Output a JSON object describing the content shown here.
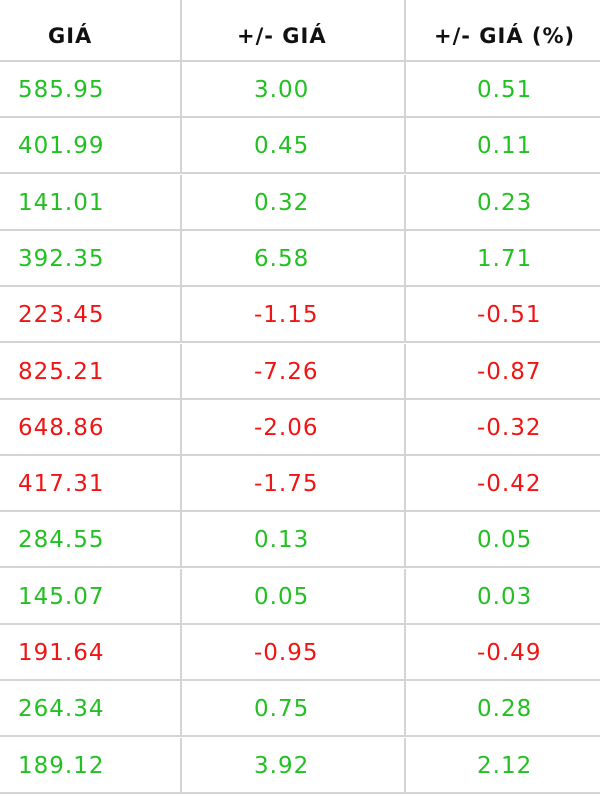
{
  "table": {
    "headers": [
      "GIÁ",
      "+/-  GIÁ",
      "+/-  GIÁ (%)"
    ],
    "rows": [
      {
        "price": "585.95",
        "change": "3.00",
        "change_pct": "0.51",
        "direction": "up"
      },
      {
        "price": "401.99",
        "change": "0.45",
        "change_pct": "0.11",
        "direction": "up"
      },
      {
        "price": "141.01",
        "change": "0.32",
        "change_pct": "0.23",
        "direction": "up"
      },
      {
        "price": "392.35",
        "change": "6.58",
        "change_pct": "1.71",
        "direction": "up"
      },
      {
        "price": "223.45",
        "change": "-1.15",
        "change_pct": "-0.51",
        "direction": "down"
      },
      {
        "price": "825.21",
        "change": "-7.26",
        "change_pct": "-0.87",
        "direction": "down"
      },
      {
        "price": "648.86",
        "change": "-2.06",
        "change_pct": "-0.32",
        "direction": "down"
      },
      {
        "price": "417.31",
        "change": "-1.75",
        "change_pct": "-0.42",
        "direction": "down"
      },
      {
        "price": "284.55",
        "change": "0.13",
        "change_pct": "0.05",
        "direction": "up"
      },
      {
        "price": "145.07",
        "change": "0.05",
        "change_pct": "0.03",
        "direction": "up"
      },
      {
        "price": "191.64",
        "change": "-0.95",
        "change_pct": "-0.49",
        "direction": "down"
      },
      {
        "price": "264.34",
        "change": "0.75",
        "change_pct": "0.28",
        "direction": "up"
      },
      {
        "price": "189.12",
        "change": "3.92",
        "change_pct": "2.12",
        "direction": "up"
      }
    ]
  },
  "colors": {
    "up": "#22c022",
    "down": "#f01515",
    "header_text": "#111111",
    "grid_line": "#d4d4d4"
  }
}
